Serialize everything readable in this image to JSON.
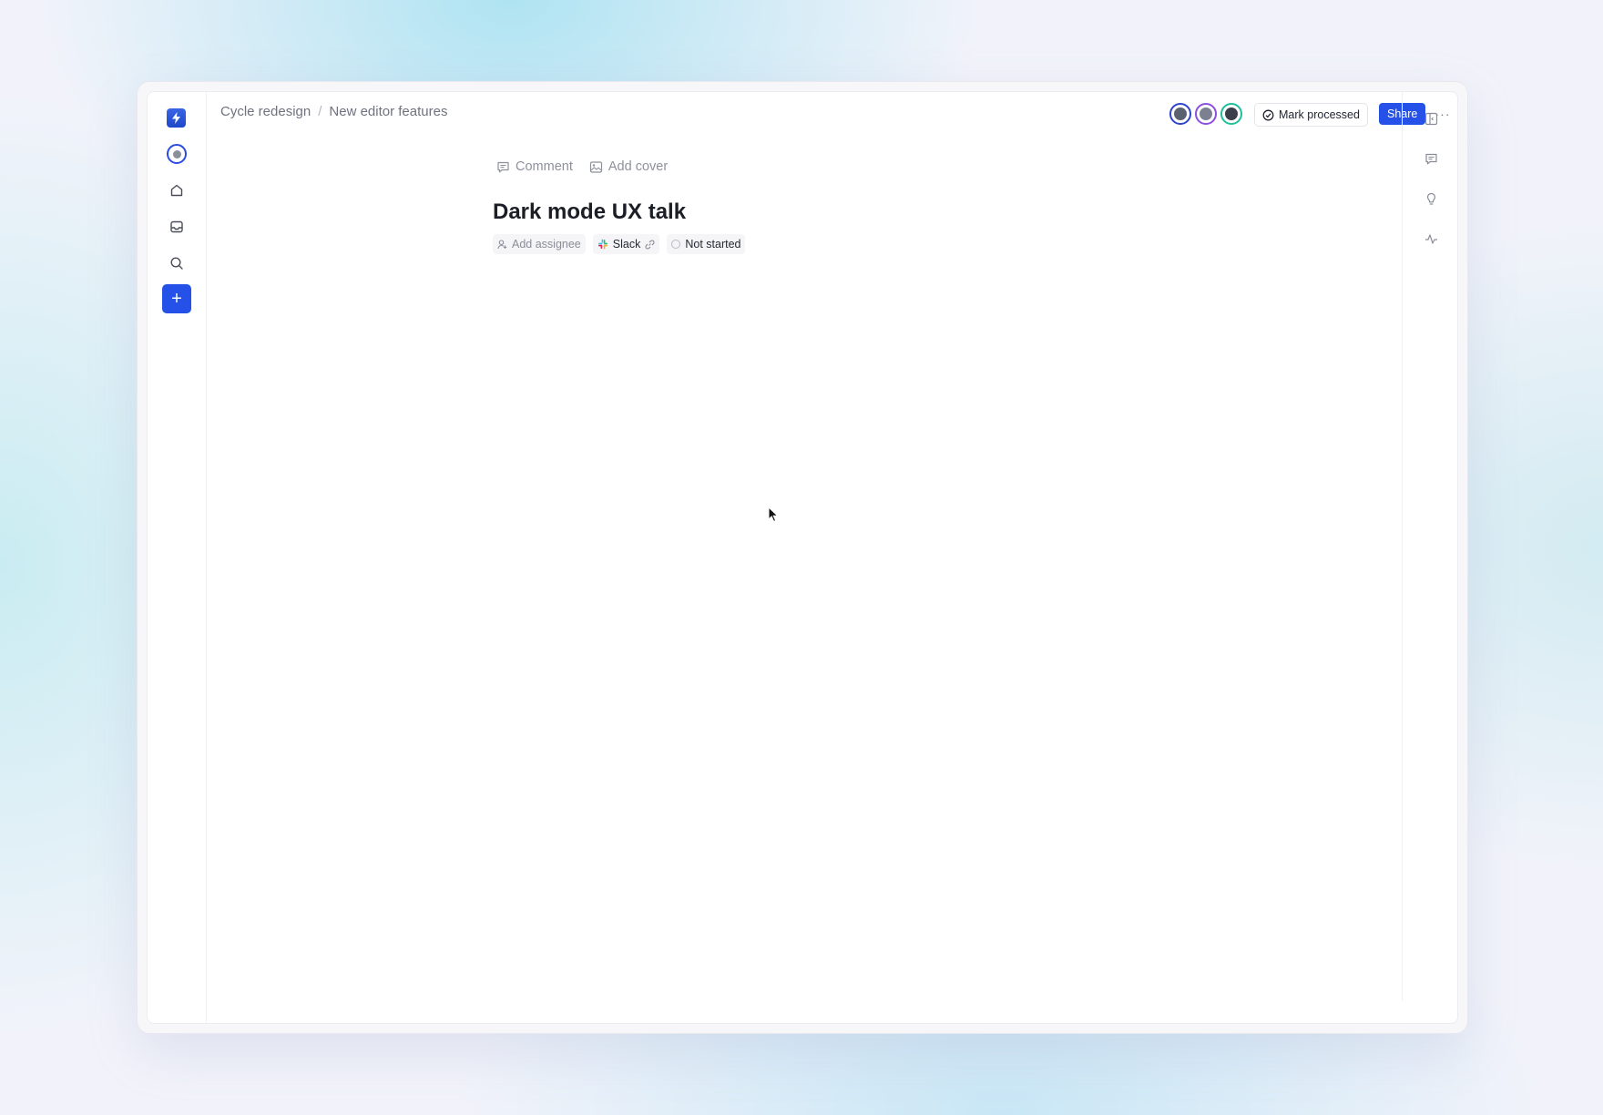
{
  "breadcrumb": {
    "parent": "Cycle redesign",
    "separator": "/",
    "current": "New editor features"
  },
  "sidebar": {
    "items": [
      {
        "name": "app-logo",
        "icon": "bolt-icon"
      },
      {
        "name": "workspace-avatar",
        "icon": "avatar"
      },
      {
        "name": "home",
        "icon": "home-icon"
      },
      {
        "name": "inbox",
        "icon": "inbox-icon"
      },
      {
        "name": "search",
        "icon": "search-icon"
      },
      {
        "name": "create",
        "icon": "plus-icon"
      }
    ],
    "create_label": "+"
  },
  "header": {
    "collaborators": [
      {
        "ring": "#2f45c9",
        "fill": "#5b6170"
      },
      {
        "ring": "#8b4fe0",
        "fill": "#7b8190"
      },
      {
        "ring": "#1fbf9a",
        "fill": "#3b3f4a"
      }
    ],
    "mark_processed_label": "Mark processed",
    "share_label": "Share",
    "more_label": "···"
  },
  "doc": {
    "comment_label": "Comment",
    "add_cover_label": "Add cover",
    "title": "Dark mode UX talk",
    "assignee_label": "Add assignee",
    "source_label": "Slack",
    "status_label": "Not started"
  },
  "right_rail": {
    "icons": [
      "panel-icon",
      "chat-icon",
      "lightbulb-icon",
      "activity-icon"
    ]
  },
  "colors": {
    "accent": "#2551e8",
    "text": "#1c1e26",
    "muted": "#8e919b"
  }
}
